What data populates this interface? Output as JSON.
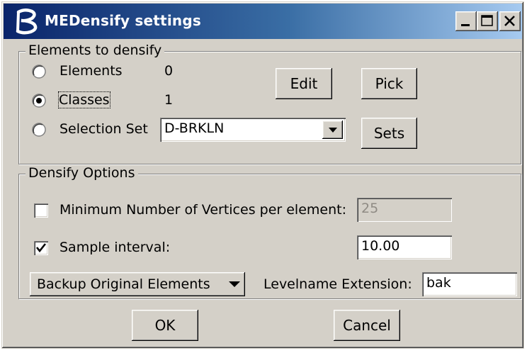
{
  "window": {
    "title": "MEDensify settings",
    "title_color": "#0a246a",
    "background": "#d4d0c8",
    "icons": {
      "app": "bentley-b-icon",
      "minimize": "minimize-icon",
      "maximize": "maximize-icon",
      "close": "close-icon"
    }
  },
  "elements_group": {
    "legend": "Elements to densify",
    "options": [
      {
        "label": "Elements",
        "count": "0",
        "checked": false
      },
      {
        "label": "Classes",
        "count": "1",
        "checked": true
      },
      {
        "label": "Selection Set",
        "checked": false
      }
    ],
    "selection_set_value": "D-BRKLN",
    "edit_label": "Edit",
    "pick_label": "Pick",
    "sets_label": "Sets"
  },
  "options_group": {
    "legend": "Densify Options",
    "min_vertices": {
      "label": "Minimum Number of Vertices per element:",
      "checked": false,
      "value": "25"
    },
    "sample_interval": {
      "label": "Sample interval:",
      "checked": true,
      "value": "10.00"
    },
    "backup_menu_label": "Backup Original Elements",
    "levelname_label": "Levelname Extension:",
    "levelname_value": "bak"
  },
  "buttons": {
    "ok_label": "OK",
    "cancel_label": "Cancel"
  }
}
